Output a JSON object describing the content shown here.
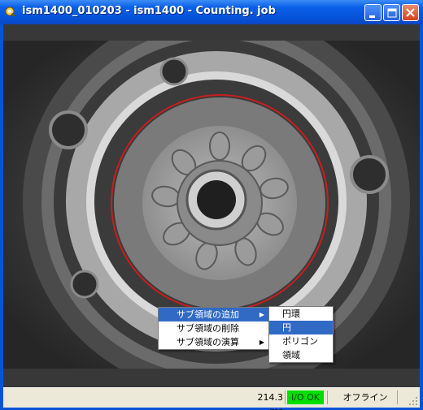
{
  "window": {
    "title": "ism1400_010203 - ism1400 - Counting. job",
    "buttons": {
      "minimize": "minimize",
      "maximize": "maximize",
      "close": "close"
    }
  },
  "status": {
    "time": "214.3 ms",
    "io": "I/O OK",
    "mode": "オフライン",
    "io_color": "#00e000"
  },
  "context_menu": {
    "items": [
      {
        "label": "サブ領域の追加",
        "has_submenu": true,
        "highlighted": true
      },
      {
        "label": "サブ領域の削除",
        "has_submenu": false,
        "highlighted": false
      },
      {
        "label": "サブ領域の演算",
        "has_submenu": true,
        "highlighted": false
      }
    ]
  },
  "submenu": {
    "items": [
      {
        "label": "円環",
        "highlighted": false
      },
      {
        "label": "円",
        "highlighted": true
      },
      {
        "label": "ポリゴン",
        "highlighted": false
      },
      {
        "label": "領域",
        "highlighted": false
      }
    ]
  },
  "colors": {
    "title_blue": "#0554da",
    "menu_highlight": "#316ac5",
    "region_circle": "#c81e1e"
  }
}
